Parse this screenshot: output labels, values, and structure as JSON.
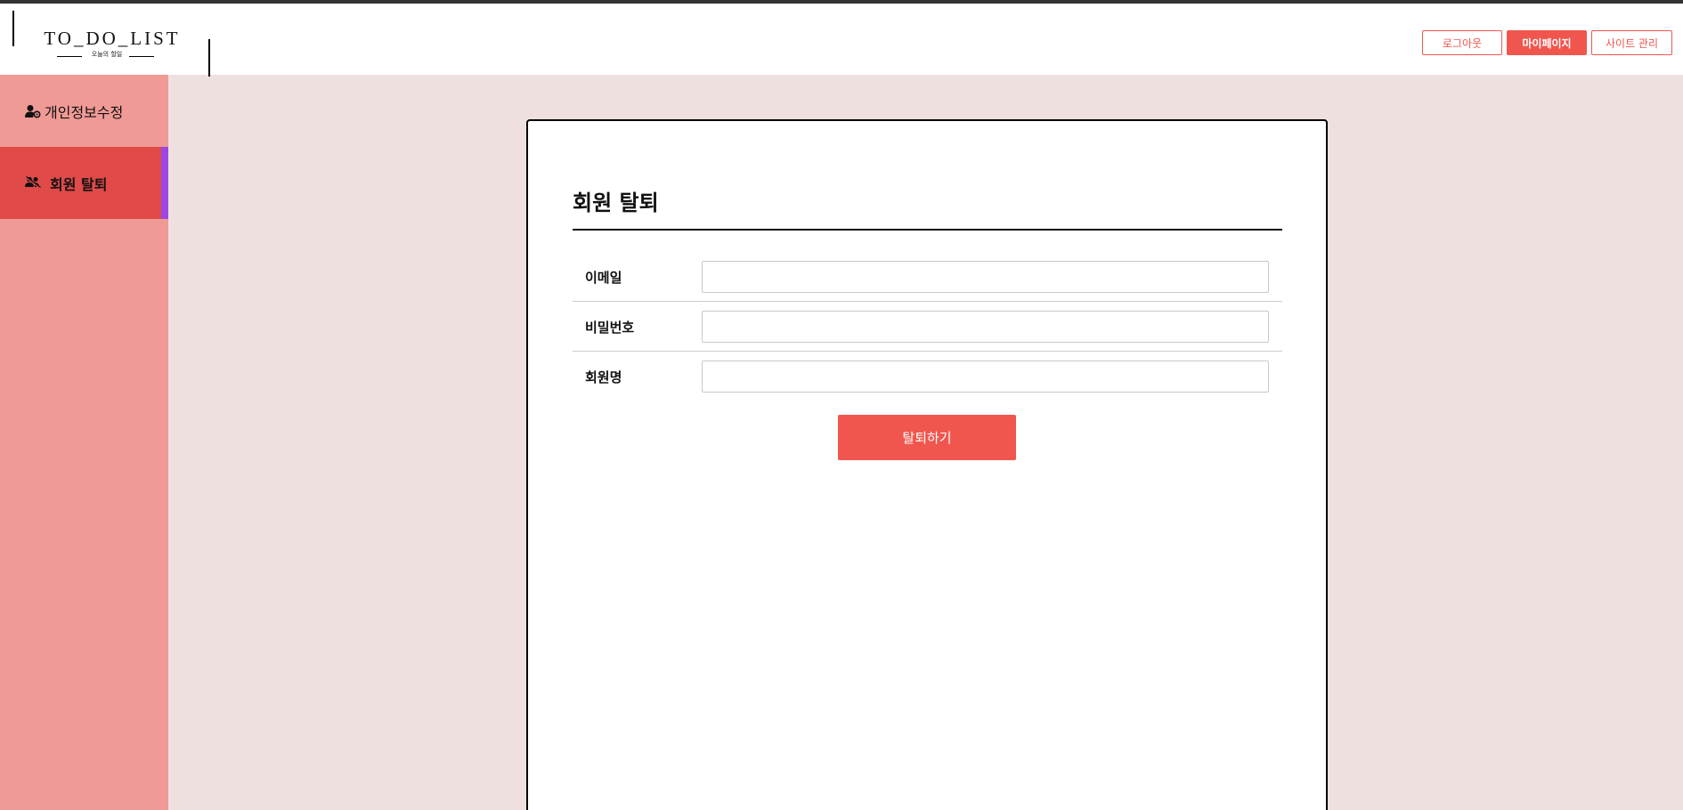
{
  "app": {
    "logo_title": "TO_DO_LIST",
    "logo_subtitle": "오늘의 할일"
  },
  "header": {
    "buttons": {
      "logout": "로그아웃",
      "mypage": "마이페이지",
      "admin": "사이트 관리"
    }
  },
  "sidebar": {
    "items": [
      {
        "label": "개인정보수정",
        "icon": "user-edit-icon"
      },
      {
        "label": "회원 탈퇴",
        "icon": "user-remove-icon",
        "active": true
      }
    ]
  },
  "main": {
    "title": "회원 탈퇴",
    "fields": [
      {
        "label": "이메일",
        "value": ""
      },
      {
        "label": "비밀번호",
        "value": ""
      },
      {
        "label": "회원명",
        "value": ""
      }
    ],
    "submit_label": "탈퇴하기"
  },
  "colors": {
    "accent": "#f0564e",
    "sidebar_bg": "#f09a96",
    "sidebar_active": "#e04a48",
    "sidebar_active_marker": "#9b47e0",
    "page_bg": "#efe0e0"
  }
}
